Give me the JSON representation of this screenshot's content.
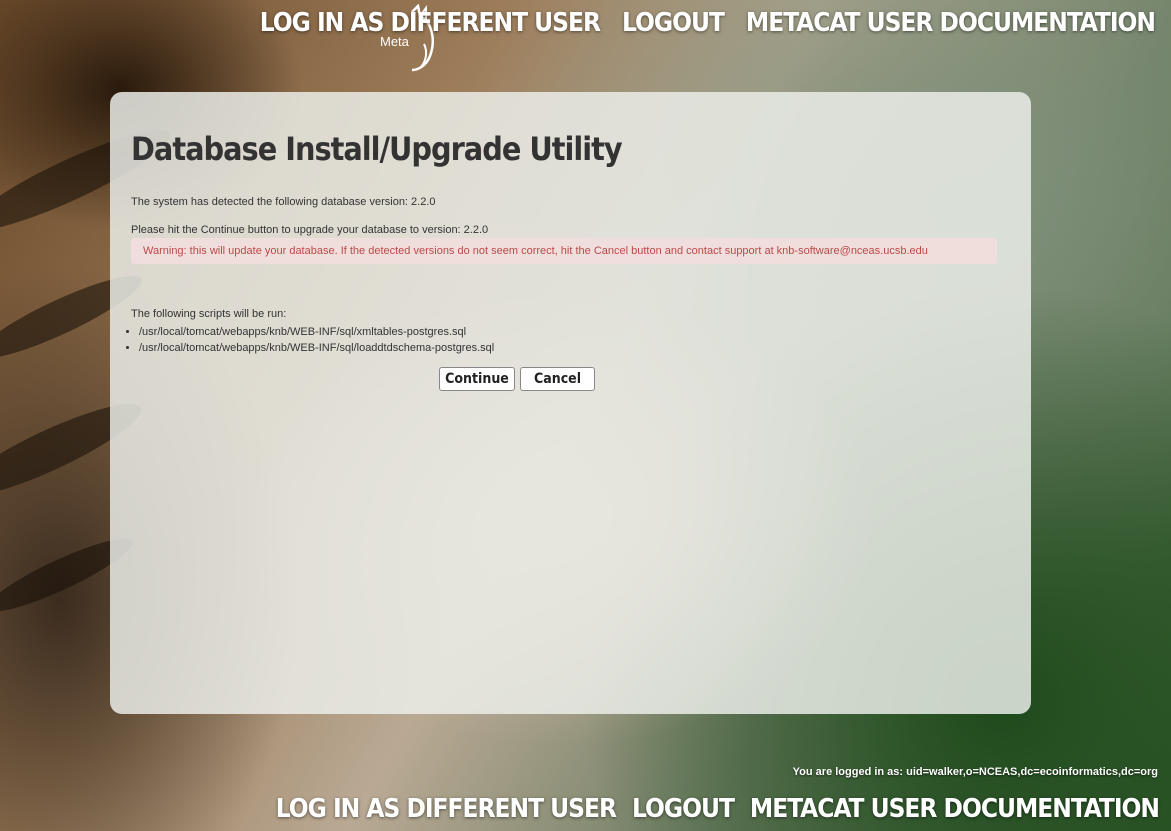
{
  "header": {
    "logo_text": "Meta",
    "nav": [
      "LOG IN AS DIFFERENT USER",
      "LOGOUT",
      "METACAT USER DOCUMENTATION"
    ]
  },
  "main": {
    "title": "Database Install/Upgrade Utility",
    "detected_text": "The system has detected the following database version: 2.2.0",
    "continue_text": "Please hit the Continue button to upgrade your database to version: 2.2.0",
    "warning": "Warning: this will update your database. If the detected versions do not seem correct, hit the Cancel button and contact support at knb-software@nceas.ucsb.edu",
    "scripts_label": "The following scripts will be run:",
    "scripts": [
      "/usr/local/tomcat/webapps/knb/WEB-INF/sql/xmltables-postgres.sql",
      "/usr/local/tomcat/webapps/knb/WEB-INF/sql/loaddtdschema-postgres.sql"
    ],
    "continue_button": "Continue",
    "cancel_button": "Cancel"
  },
  "footer": {
    "logged_in": "You are logged in as: uid=walker,o=NCEAS,dc=ecoinformatics,dc=org",
    "nav": [
      "LOG IN AS DIFFERENT USER",
      "LOGOUT",
      "METACAT USER DOCUMENTATION"
    ]
  },
  "colors": {
    "warning_text": "#b94a48",
    "warning_bg": "#f2dede",
    "panel_bg": "#eceeea"
  }
}
